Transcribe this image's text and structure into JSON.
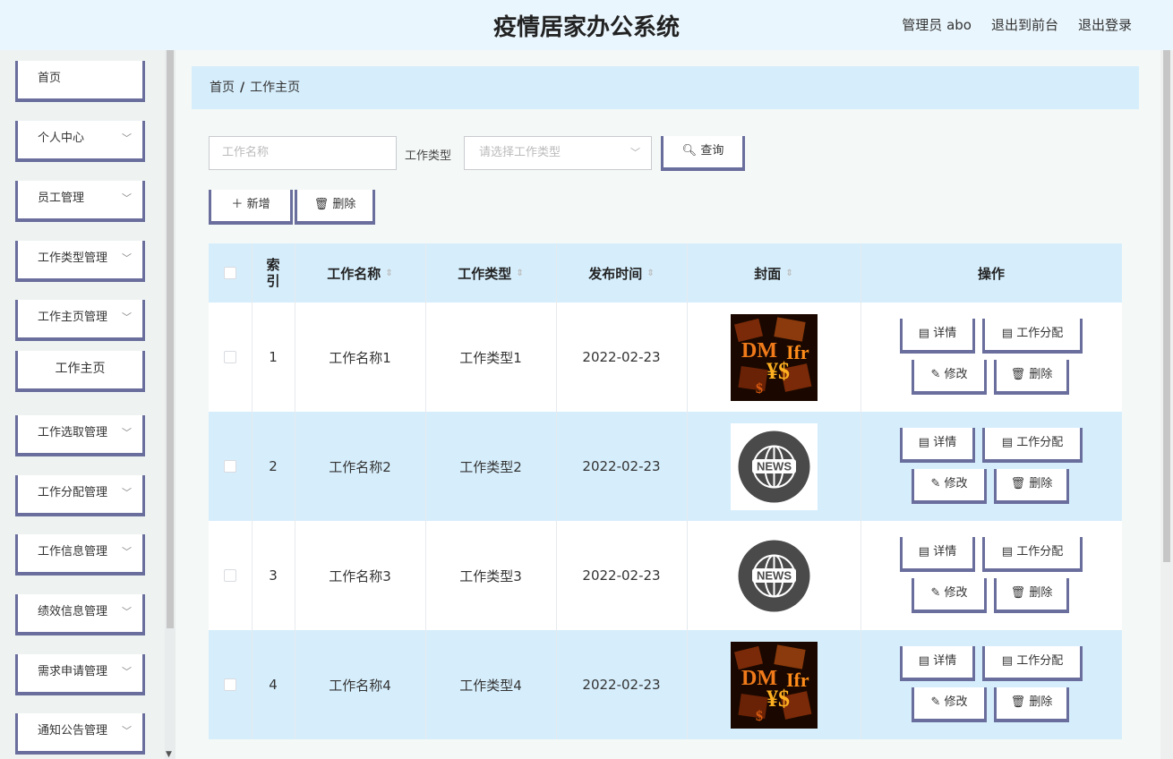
{
  "header": {
    "title": "疫情居家办公系统",
    "user": "管理员 abo",
    "to_front": "退出到前台",
    "logout": "退出登录"
  },
  "sidebar": {
    "items": [
      {
        "label": "首页"
      },
      {
        "label": "个人中心"
      },
      {
        "label": "员工管理"
      },
      {
        "label": "工作类型管理"
      },
      {
        "label": "工作主页管理"
      },
      {
        "label": "工作主页"
      },
      {
        "label": "工作选取管理"
      },
      {
        "label": "工作分配管理"
      },
      {
        "label": "工作信息管理"
      },
      {
        "label": "绩效信息管理"
      },
      {
        "label": "需求申请管理"
      },
      {
        "label": "通知公告管理"
      }
    ]
  },
  "breadcrumb": {
    "home": "首页",
    "sep": "/",
    "current": "工作主页"
  },
  "search": {
    "name_placeholder": "工作名称",
    "type_label": "工作类型",
    "type_placeholder": "请选择工作类型",
    "query_label": "查询"
  },
  "toolbar": {
    "add_label": "新增",
    "delete_label": "删除"
  },
  "table": {
    "columns": [
      "索引",
      "工作名称",
      "工作类型",
      "发布时间",
      "封面",
      "操作"
    ],
    "rows": [
      {
        "index": "1",
        "name": "工作名称1",
        "type": "工作类型1",
        "date": "2022-02-23",
        "cover": "money-fire"
      },
      {
        "index": "2",
        "name": "工作名称2",
        "type": "工作类型2",
        "date": "2022-02-23",
        "cover": "news-globe"
      },
      {
        "index": "3",
        "name": "工作名称3",
        "type": "工作类型3",
        "date": "2022-02-23",
        "cover": "news-globe"
      },
      {
        "index": "4",
        "name": "工作名称4",
        "type": "工作类型4",
        "date": "2022-02-23",
        "cover": "money-fire"
      }
    ],
    "actions": {
      "detail": "详情",
      "assign": "工作分配",
      "edit": "修改",
      "delete": "删除"
    }
  },
  "icons": {
    "news_badge": "NEWS",
    "money_text": "DM ¥ $ Ifr"
  }
}
